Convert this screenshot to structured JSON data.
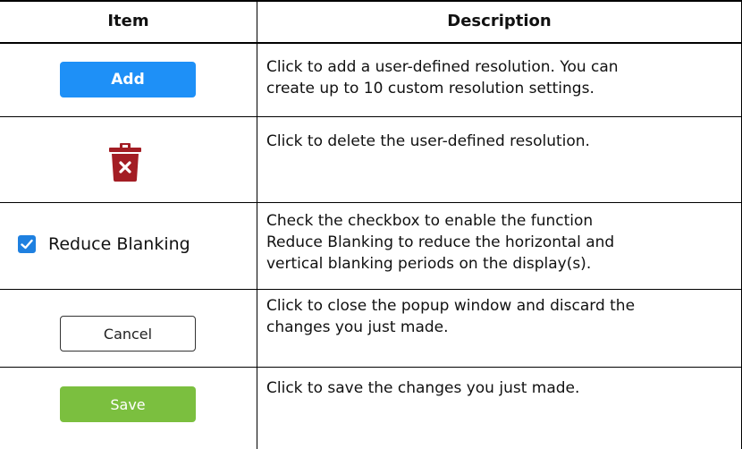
{
  "table": {
    "headers": {
      "item": "Item",
      "description": "Description"
    },
    "rows": [
      {
        "item": {
          "type": "button",
          "label": "Add",
          "color": "#1e90f7"
        },
        "description": [
          "Click to add a user-defined resolution. You can",
          "create up to 10 custom resolution settings."
        ]
      },
      {
        "item": {
          "type": "icon",
          "icon": "trash-icon",
          "color": "#a31d24"
        },
        "description": [
          "Click to delete the user-defined resolution."
        ]
      },
      {
        "item": {
          "type": "checkbox",
          "label": "Reduce Blanking",
          "checked": true,
          "color": "#1e80e0"
        },
        "description": [
          "Check the checkbox to enable the function",
          "Reduce Blanking to reduce the horizontal and",
          "vertical blanking periods on the display(s)."
        ]
      },
      {
        "item": {
          "type": "button",
          "label": "Cancel",
          "color": "#ffffff"
        },
        "description": [
          "Click to close the popup window and discard the",
          "changes you just made."
        ]
      },
      {
        "item": {
          "type": "button",
          "label": "Save",
          "color": "#7bbf3f"
        },
        "description": [
          "Click to save the changes you just made."
        ]
      }
    ]
  }
}
